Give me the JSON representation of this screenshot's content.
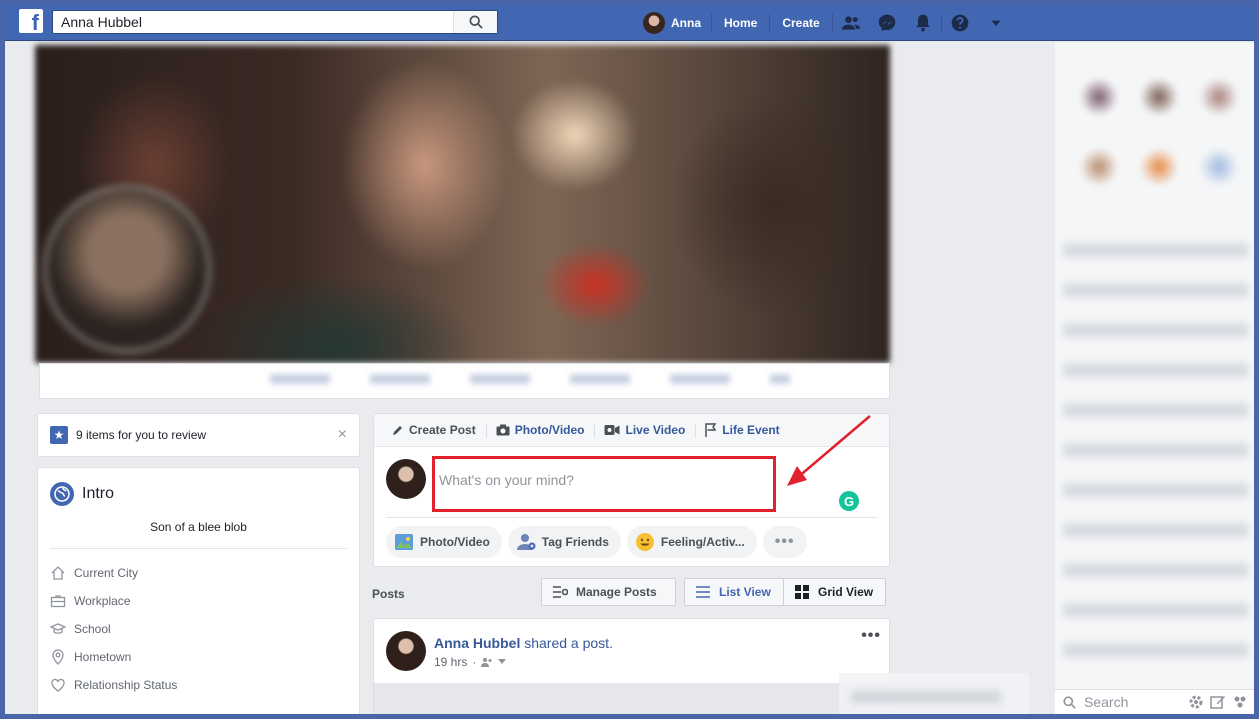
{
  "topbar": {
    "logo": "f",
    "search_value": "Anna Hubbel",
    "user_name": "Anna",
    "home_label": "Home",
    "create_label": "Create",
    "icons": [
      "friends-icon",
      "messenger-icon",
      "notifications-icon",
      "help-icon",
      "dropdown-icon"
    ]
  },
  "review": {
    "text": "9 items for you to review",
    "close": "×"
  },
  "intro": {
    "title": "Intro",
    "bio": "Son of a blee blob",
    "items": [
      {
        "label": "Current City",
        "icon": "home-icon"
      },
      {
        "label": "Workplace",
        "icon": "briefcase-icon"
      },
      {
        "label": "School",
        "icon": "graduation-cap-icon"
      },
      {
        "label": "Hometown",
        "icon": "location-pin-icon"
      },
      {
        "label": "Relationship Status",
        "icon": "heart-icon"
      }
    ]
  },
  "composer": {
    "tabs": [
      {
        "label": "Create Post",
        "icon": "pencil-icon"
      },
      {
        "label": "Photo/Video",
        "icon": "camera-icon"
      },
      {
        "label": "Live Video",
        "icon": "video-icon"
      },
      {
        "label": "Life Event",
        "icon": "flag-icon"
      }
    ],
    "placeholder": "What's on your mind?",
    "grammarly": "G",
    "actions": [
      {
        "label": "Photo/Video",
        "icon": "photo-icon"
      },
      {
        "label": "Tag Friends",
        "icon": "tag-friends-icon"
      },
      {
        "label": "Feeling/Activ...",
        "icon": "smiley-icon"
      }
    ],
    "more": "•••"
  },
  "posts": {
    "label": "Posts",
    "manage_label": "Manage Posts",
    "list_label": "List View",
    "grid_label": "Grid View"
  },
  "post": {
    "author": "Anna Hubbel",
    "action": "shared a post.",
    "time": "19 hrs",
    "more": "•••"
  },
  "sidebar": {
    "search_placeholder": "Search"
  },
  "colors": {
    "brand": "#4267b2",
    "link": "#365899",
    "highlight": "#e0212d",
    "grammarly": "#15c39a"
  }
}
